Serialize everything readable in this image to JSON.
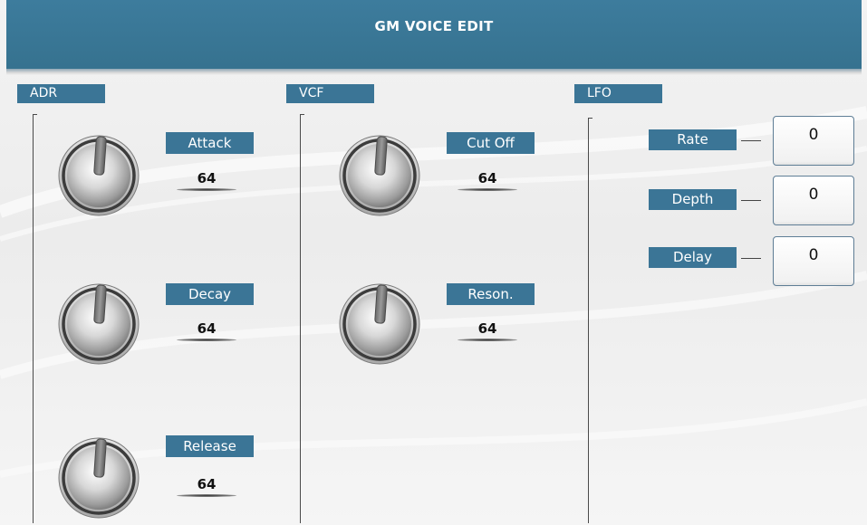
{
  "header": {
    "title": "GM VOICE EDIT"
  },
  "sections": {
    "adr": {
      "label": "ADR",
      "params": [
        {
          "label": "Attack",
          "value": "64"
        },
        {
          "label": "Decay",
          "value": "64"
        },
        {
          "label": "Release",
          "value": "64"
        }
      ]
    },
    "vcf": {
      "label": "VCF",
      "params": [
        {
          "label": "Cut Off",
          "value": "64"
        },
        {
          "label": "Reson.",
          "value": "64"
        }
      ]
    },
    "lfo": {
      "label": "LFO",
      "params": [
        {
          "label": "Rate",
          "value": "0"
        },
        {
          "label": "Depth",
          "value": "0"
        },
        {
          "label": "Delay",
          "value": "0"
        }
      ]
    }
  },
  "colors": {
    "header_bg": "#3b7a9b",
    "tag_bg": "#3b7596",
    "page_bg": "#efefef",
    "value_box_border": "#5f7e96"
  },
  "icons": {
    "knob": "rotary-knob-icon"
  }
}
